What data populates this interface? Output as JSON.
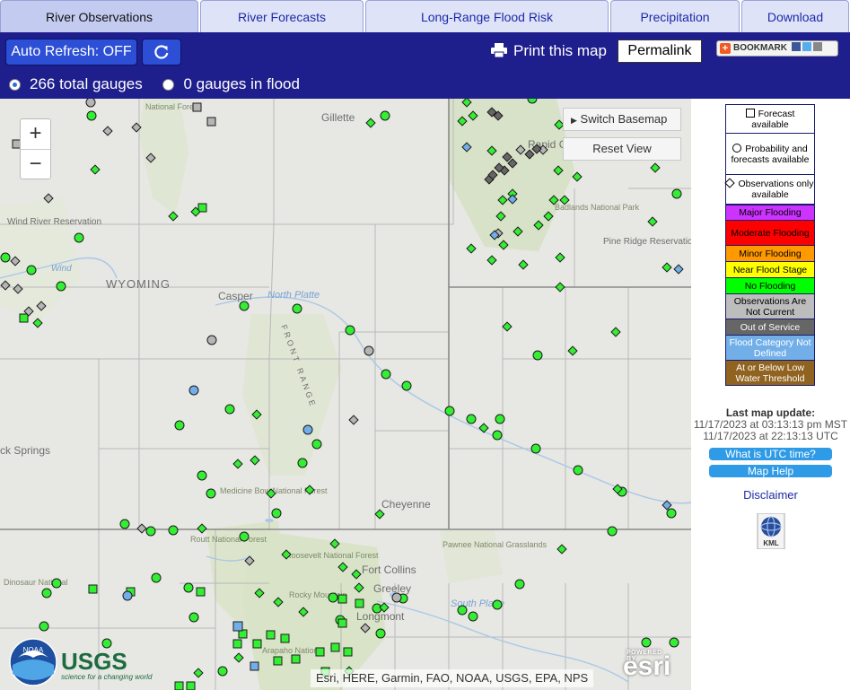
{
  "tabs": [
    {
      "label": "River Observations",
      "active": true
    },
    {
      "label": "River Forecasts",
      "active": false
    },
    {
      "label": "Long-Range Flood Risk",
      "active": false
    },
    {
      "label": "Precipitation",
      "active": false
    },
    {
      "label": "Download",
      "active": false
    }
  ],
  "toolbar": {
    "auto_refresh": "Auto Refresh: OFF",
    "refresh_icon": "refresh-icon",
    "print_label": "Print this map",
    "permalink": "Permalink",
    "bookmark": "BOOKMARK"
  },
  "gauges": {
    "total_label": "266 total gauges",
    "flood_label": "0 gauges in flood"
  },
  "map": {
    "zoom_in": "+",
    "zoom_out": "−",
    "switch_basemap": "Switch Basemap",
    "reset_view": "Reset View",
    "attribution": "Esri, HERE, Garmin, FAO, NOAA, USGS, EPA, NPS",
    "esri_powered": "POWERED BY",
    "esri": "esri",
    "usgs": "USGS",
    "usgs_tagline": "science for a changing world",
    "noaa": "NOAA",
    "labels": {
      "gillette": "Gillette",
      "wyoming": "WYOMING",
      "casper": "Casper",
      "north_platte": "North Platte",
      "cheyenne": "Cheyenne",
      "fort_collins": "Fort Collins",
      "greeley": "Greeley",
      "longmont": "Longmont",
      "rapid_city": "Rapid C",
      "pine_ridge": "Pine Ridge Reservation",
      "wind_river": "Wind River Reservation",
      "wind": "Wind",
      "rock_springs": "ck Springs",
      "medicine_bow": "Medicine Bow National Forest",
      "routt": "Routt National Forest",
      "roosevelt": "Roosevelt National Forest",
      "rocky": "Rocky Mountain",
      "pawnee": "Pawnee National Grasslands",
      "dinosaur": "Dinosaur National",
      "south_platte": "South Platte",
      "front_range": "FRONT RANGE",
      "national_forest": "National Forest",
      "badlands": "Badlands National Park",
      "arapaho": "Arapaho National"
    }
  },
  "legend": {
    "forecast": "Forecast available",
    "probability": "Probability and forecasts available",
    "observations": "Observations only available",
    "categories": [
      {
        "label": "Major Flooding",
        "color": "#cc33ff",
        "text": "#000000"
      },
      {
        "label": "Moderate Flooding",
        "color": "#ff0000",
        "text": "#000000"
      },
      {
        "label": "Minor Flooding",
        "color": "#ff9900",
        "text": "#000000"
      },
      {
        "label": "Near Flood Stage",
        "color": "#ffff00",
        "text": "#000000"
      },
      {
        "label": "No Flooding",
        "color": "#00ff00",
        "text": "#000000"
      },
      {
        "label": "Observations Are Not Current",
        "color": "#bdbdbd",
        "text": "#000000"
      },
      {
        "label": "Out of Service",
        "color": "#666666",
        "text": "#ffffff"
      },
      {
        "label": "Flood Category Not Defined",
        "color": "#72afe9",
        "text": "#ffffff"
      },
      {
        "label": "At or Below Low Water Threshold",
        "color": "#906320",
        "text": "#ffffff"
      }
    ]
  },
  "update": {
    "title": "Last map update:",
    "mst": "11/17/2023 at 03:13:13 pm MST",
    "utc": "11/17/2023 at 22:13:13 UTC"
  },
  "links": {
    "utc_time": "What is UTC time?",
    "map_help": "Map Help",
    "disclaimer": "Disclaimer",
    "kml": "KML"
  },
  "colors": {
    "header_bg": "#1e1e8c",
    "no_flooding": "#33ee33",
    "not_current": "#b5b5b5",
    "out_of_service": "#666666",
    "not_defined": "#72afe9"
  }
}
